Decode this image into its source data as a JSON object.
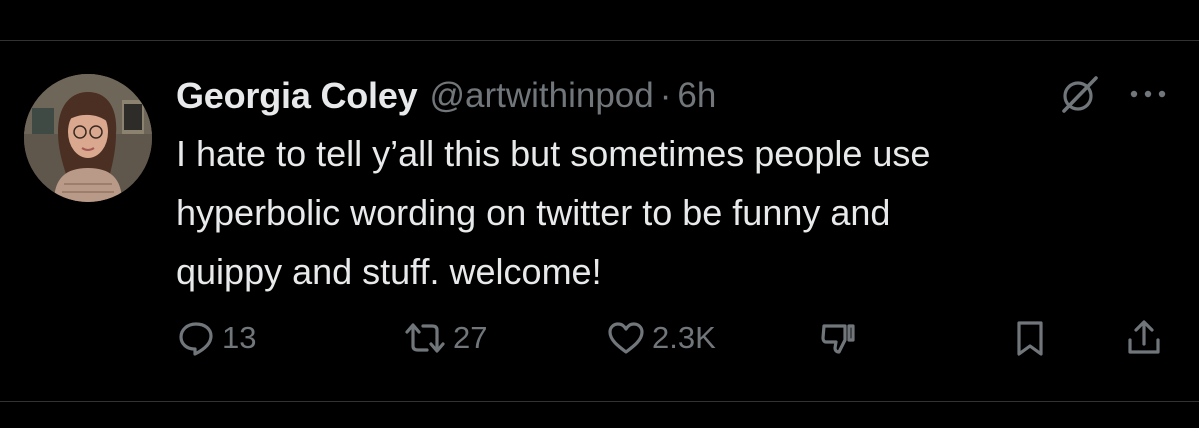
{
  "tweet": {
    "display_name": "Georgia Coley",
    "handle": "@artwithinpod",
    "separator": "·",
    "time": "6h",
    "text_lines": [
      "I hate to tell y’all this but sometimes people use",
      "hyperbolic wording on twitter to be funny and",
      "quippy and stuff. welcome!"
    ]
  },
  "actions": {
    "reply_count": "13",
    "retweet_count": "27",
    "like_count": "2.3K"
  },
  "icons": {
    "grok": "grok-icon",
    "more": "more-icon",
    "reply": "reply-icon",
    "retweet": "retweet-icon",
    "like": "heart-icon",
    "downvote": "downvote-icon",
    "bookmark": "bookmark-icon",
    "share": "share-icon"
  },
  "colors": {
    "background": "#000000",
    "primary_text": "#e7e9ea",
    "secondary_text": "#71767b",
    "divider": "#2f3336"
  }
}
